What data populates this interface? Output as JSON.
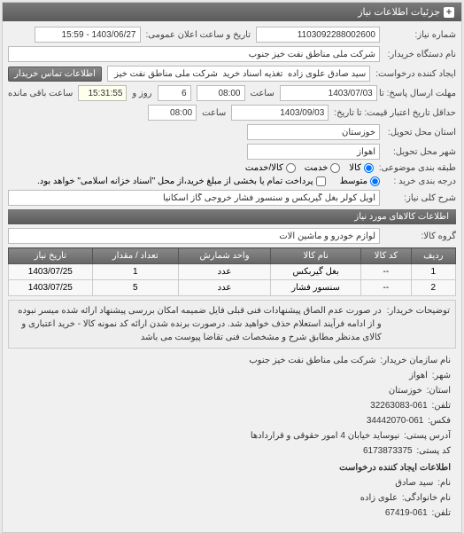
{
  "header": {
    "title": "جزئیات اطلاعات نیاز",
    "plus": "+"
  },
  "form": {
    "need_no_label": "شماره نیاز:",
    "need_no": "1103092288002600",
    "announce_label": "تاریخ و ساعت اعلان عمومی:",
    "announce_val": "1403/06/27 - 15:59",
    "buyer_org_label": "نام دستگاه خریدار:",
    "buyer_org": "شرکت ملی مناطق نفت خیز جنوب",
    "requester_label": "ایجاد کننده درخواست:",
    "requester": "سید صادق علوی زاده  تغذیه اسناد خرید  شرکت ملی مناطق نفت خیز جنوب",
    "contact_btn": "اطلاعات تماس خریدار",
    "deadline_label": "مهلت ارسال پاسخ: تا",
    "deadline_date": "1403/07/03",
    "time_label": "ساعت",
    "deadline_time": "08:00",
    "remain_day_label": "روز و",
    "remain_days": "6",
    "remain_time": "15:31:55",
    "remain_suffix": "ساعت باقی مانده",
    "validity_label": "حداقل تاریخ اعتبار قیمت: تا تاریخ:",
    "validity_date": "1403/09/03",
    "validity_time": "08:00",
    "province_label": "استان محل تحویل:",
    "province": "خوزستان",
    "city_label": "شهر محل تحویل:",
    "city": "اهواز",
    "pkg_label": "طبقه بندی موضوعی:",
    "pkg_all": "کالا",
    "pkg_service": "خدمت",
    "pkg_both": "کالا/خدمت",
    "priority_label": "درجه بندی خرید :",
    "priority_val": "متوسط",
    "pay_note": "پرداخت تمام یا بخشی از مبلغ خرید،از محل \"اسناد خزانه اسلامی\" خواهد بود.",
    "keyword_label": "شرح کلی نیاز:",
    "keyword": "اویل کولر بغل گیربکس و سنسور فشار خروجی گاز اسکانیا"
  },
  "section_goods": "اطلاعات کالاهای مورد نیاز",
  "goods_group_label": "گروه کالا:",
  "goods_group": "لوازم خودرو و ماشین آلات",
  "table": {
    "headers": [
      "ردیف",
      "کد کالا",
      "نام کالا",
      "واحد شمارش",
      "تعداد / مقدار",
      "تاریخ نیاز"
    ],
    "rows": [
      [
        "1",
        "--",
        "بغل گیربکس",
        "عدد",
        "1",
        "1403/07/25"
      ],
      [
        "2",
        "--",
        "سنسور فشار",
        "عدد",
        "5",
        "1403/07/25"
      ]
    ]
  },
  "buyer_note_label": "توضیحات خریدار:",
  "buyer_note": "در صورت عدم الصاق پیشنهادات فنی قبلی فایل ضمیمه امکان بررسی پیشنهاد ارائه شده میسر نبوده و از ادامه فرآیند استعلام حذف خواهید شد. درصورت برنده شدن ارائه کد نمونه کالا - خرید اعتباری و کالای مدنظر مطابق شرح و مشخصات فنی تقاضا پیوست می باشد",
  "info": {
    "buyer_org_label": "نام سازمان خریدار:",
    "buyer_org_val": "شرکت ملی مناطق نفت خیز جنوب",
    "city_label": "شهر:",
    "city_val": "اهواز",
    "province_label": "استان:",
    "province_val": "خوزستان",
    "phone_label": "تلفن:",
    "phone_val": "061-32263083",
    "fax_label": "فکس:",
    "fax_val": "061-34442070",
    "addr_label": "آدرس پستی:",
    "addr_val": "نیوساید خیابان 4 امور حقوقی و قراردادها",
    "postal_label": "کد پستی:",
    "postal_val": "6173873375",
    "creator_title": "اطلاعات ایجاد کننده درخواست",
    "name_label": "نام:",
    "name_val": "سید صادق",
    "family_label": "نام خانوادگی:",
    "family_val": "علوی زاده",
    "tel_label": "تلفن:",
    "tel_val": "061-67419"
  }
}
